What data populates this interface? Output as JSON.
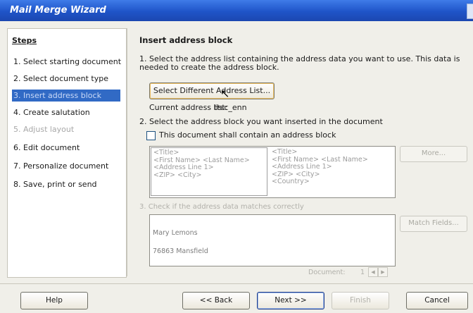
{
  "window": {
    "title": "Mail Merge Wizard"
  },
  "steps": {
    "heading": "Steps",
    "items": [
      {
        "label": "1. Select starting document"
      },
      {
        "label": "2. Select document type"
      },
      {
        "label": "3. Insert address block"
      },
      {
        "label": "4. Create salutation"
      },
      {
        "label": "5. Adjust layout"
      },
      {
        "label": "6. Edit document"
      },
      {
        "label": "7. Personalize document"
      },
      {
        "label": "8. Save, print or send"
      }
    ]
  },
  "main": {
    "title": "Insert address block",
    "instruction1": "1. Select the address list containing the address data you want to use. This data is needed to create the address block.",
    "select_list_button": "Select Different Address List...",
    "current_list_label": "Current address list:",
    "current_list_value": "ttsc_enn",
    "instruction2": "2. Select the address block you want inserted in the document",
    "checkbox_label": "This document shall contain an address block",
    "checkbox_checked": false,
    "blocks": [
      {
        "lines": [
          "<Title>",
          "<First Name> <Last Name>",
          "<Address Line 1>",
          "<ZIP> <City>"
        ]
      },
      {
        "lines": [
          "<Title>",
          "<First Name> <Last Name>",
          "<Address Line 1>",
          "<ZIP> <City>",
          "<Country>"
        ]
      }
    ],
    "more_button": "More...",
    "instruction3": "3. Check if the address data matches correctly",
    "match_fields_button": "Match Fields...",
    "preview_lines": [
      "Mary Lemons",
      "76863 Mansfield"
    ],
    "document_label": "Document:",
    "document_value": "1"
  },
  "footer": {
    "help": "Help",
    "back": "<< Back",
    "next": "Next >>",
    "finish": "Finish",
    "cancel": "Cancel"
  },
  "colors": {
    "titlebar": "#1f54c8",
    "active_step_bg": "#316ac5",
    "dialog_bg": "#f0efe9"
  }
}
